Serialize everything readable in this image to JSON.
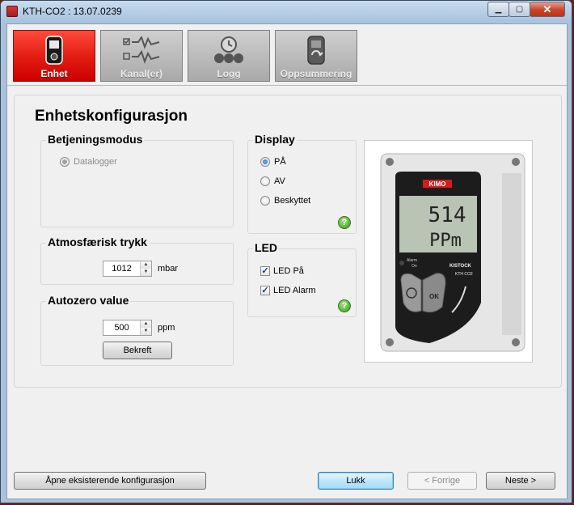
{
  "window": {
    "title": "KTH-CO2 : 13.07.0239"
  },
  "tabs": [
    {
      "label": "Enhet",
      "icon": "device-icon",
      "active": true
    },
    {
      "label": "Kanal(er)",
      "icon": "channels-icon",
      "active": false
    },
    {
      "label": "Logg",
      "icon": "clock-icon",
      "active": false
    },
    {
      "label": "Oppsummering",
      "icon": "summary-icon",
      "active": false
    }
  ],
  "page": {
    "heading": "Enhetskonfigurasjon"
  },
  "operating_mode": {
    "title": "Betjeningsmodus",
    "option": "Datalogger",
    "selected": true,
    "enabled": false
  },
  "display": {
    "title": "Display",
    "options": [
      {
        "label": "PÅ",
        "selected": true
      },
      {
        "label": "AV",
        "selected": false
      },
      {
        "label": "Beskyttet",
        "selected": false
      }
    ]
  },
  "pressure": {
    "title": "Atmosfærisk trykk",
    "value": "1012",
    "unit": "mbar"
  },
  "led": {
    "title": "LED",
    "options": [
      {
        "label": "LED På",
        "checked": true
      },
      {
        "label": "LED Alarm",
        "checked": true
      }
    ]
  },
  "autozero": {
    "title": "Autozero value",
    "value": "500",
    "unit": "ppm",
    "confirm_label": "Bekreft"
  },
  "device_image": {
    "brand": "KIMO",
    "display_line1": "514",
    "display_line2": "PPm",
    "model_line1": "KISTOCK",
    "model_line2": "KTH CO2",
    "led_labels": [
      "Alarm",
      "On"
    ],
    "ok_label": "OK"
  },
  "footer": {
    "open_config_label": "Åpne eksisterende konfigurasjon",
    "close_label": "Lukk",
    "prev_label": "< Forrige",
    "next_label": "Neste >"
  },
  "colors": {
    "active_tab": "#e11b10",
    "inactive_tab": "#b5b5b5",
    "help": "#3b9a1c"
  }
}
